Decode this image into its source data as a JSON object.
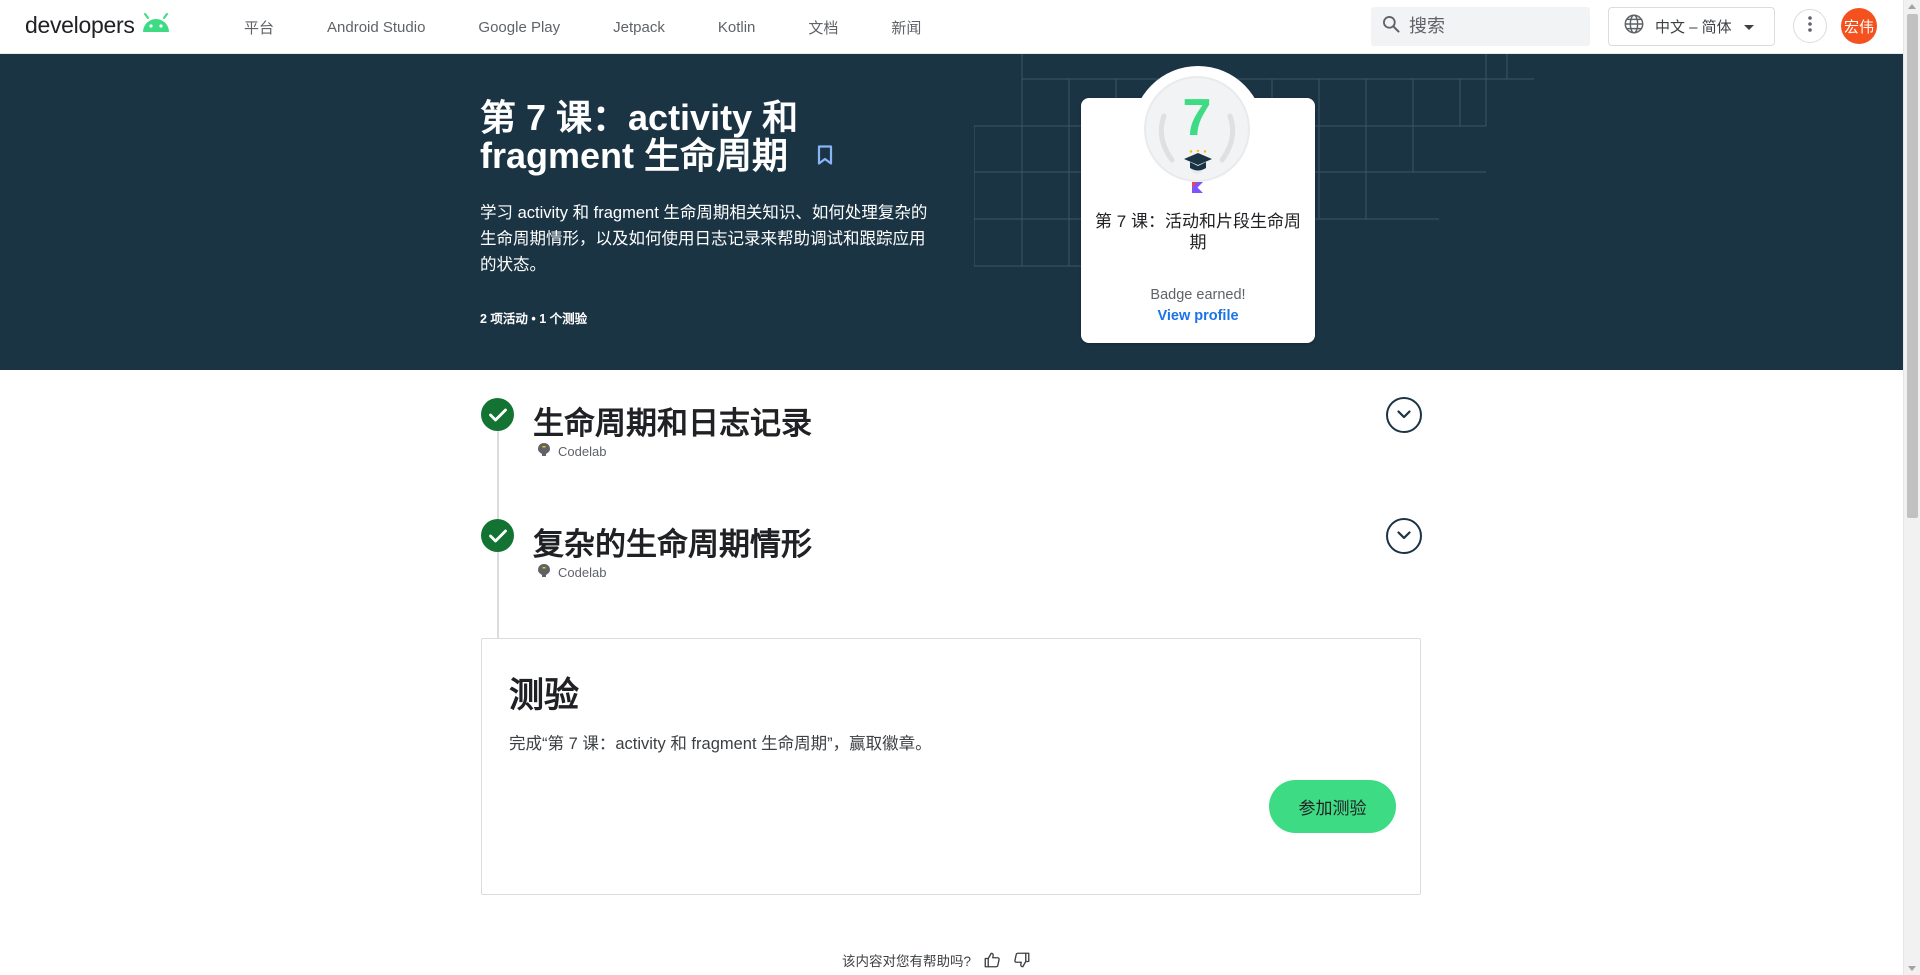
{
  "header": {
    "logo_text": "developers",
    "nav": [
      "平台",
      "Android Studio",
      "Google Play",
      "Jetpack",
      "Kotlin",
      "文档",
      "新闻"
    ],
    "search_placeholder": "搜索",
    "language": "中文 – 简体",
    "avatar_initials": "宏伟"
  },
  "hero": {
    "title": "第 7 课：activity 和 fragment 生命周期",
    "description": "学习 activity 和 fragment 生命周期相关知识、如何处理复杂的生命周期情形，以及如何使用日志记录来帮助调试和跟踪应用的状态。",
    "meta": "2 项活动 • 1 个测验",
    "badge": {
      "number": "7",
      "title": "第 7 课：活动和片段生命周期",
      "earned": "Badge earned!",
      "link": "View profile"
    }
  },
  "activities": [
    {
      "title": "生命周期和日志记录",
      "type": "Codelab",
      "completed": true
    },
    {
      "title": "复杂的生命周期情形",
      "type": "Codelab",
      "completed": true
    }
  ],
  "quiz": {
    "title": "测验",
    "description": "完成“第 7 课：activity 和 fragment 生命周期”，赢取徽章。",
    "button": "参加测验"
  },
  "feedback": {
    "question": "该内容对您有帮助吗?"
  },
  "colors": {
    "hero_bg": "#1b3444",
    "accent_green": "#3ddc84",
    "check_green": "#137333",
    "avatar": "#f4511e",
    "link_blue": "#1a73e8"
  }
}
